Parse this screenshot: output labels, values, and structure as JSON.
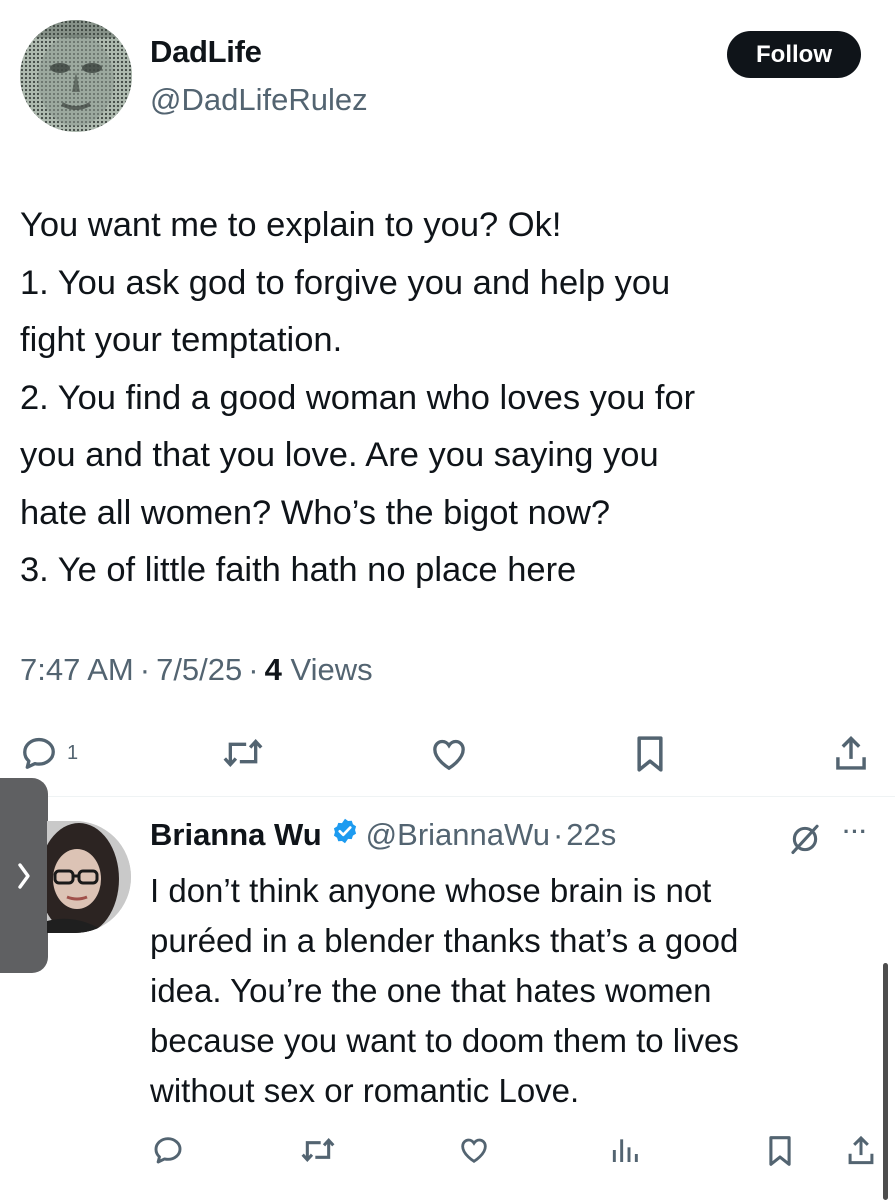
{
  "tweet": {
    "display_name": "DadLife",
    "handle": "@DadLifeRulez",
    "follow_label": "Follow",
    "lines": [
      "You want me to explain to you? Ok!",
      "1. You ask god to forgive you and help you",
      "fight your temptation.",
      "2. You find a good woman who loves you for",
      "you and that you love. Are you saying you",
      "hate all women? Who’s the bigot now?",
      "3. Ye of little faith hath no place here"
    ],
    "time": "7:47 AM",
    "date": "7/5/25",
    "separator": "·",
    "views_count": "4",
    "views_label": "Views",
    "actions": {
      "reply_icon": "reply-icon",
      "reply_count": "1",
      "retweet_icon": "retweet-icon",
      "like_icon": "heart-icon",
      "bookmark_icon": "bookmark-icon",
      "share_icon": "share-icon"
    }
  },
  "side_tab": {
    "icon": "chevron-right-icon",
    "glyph": "›"
  },
  "reply": {
    "display_name": "Brianna Wu",
    "verified_icon": "verified-badge-icon",
    "handle": "@BriannaWu",
    "separator": "·",
    "time": "22s",
    "grok_icon": "grok-icon",
    "more_label": "···",
    "lines": [
      "I don’t think anyone whose brain is not",
      "puréed in a blender thanks that’s a good",
      "idea. You’re the one that hates women",
      "because you want to doom them to lives",
      "without sex or romantic Love."
    ],
    "actions": {
      "reply_icon": "reply-icon",
      "retweet_icon": "retweet-icon",
      "like_icon": "heart-icon",
      "analytics_icon": "analytics-icon",
      "bookmark_icon": "bookmark-icon",
      "share_icon": "share-icon"
    }
  },
  "colors": {
    "text": "#0f1419",
    "secondary": "#536471",
    "verified": "#1d9bf0",
    "follow_bg": "#0f1419",
    "side_tab": "#5f6062"
  }
}
